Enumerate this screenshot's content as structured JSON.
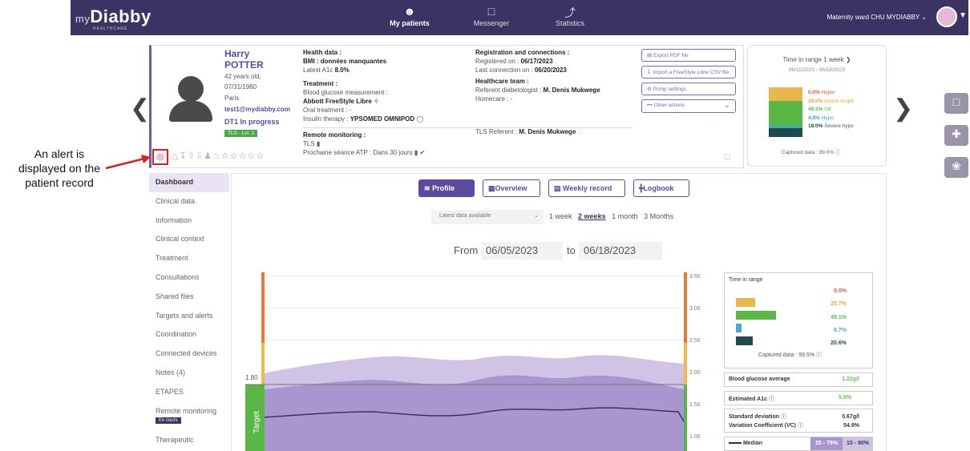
{
  "annotation": {
    "text_line1": "An alert is",
    "text_line2": "displayed on the",
    "text_line3": "patient record"
  },
  "topbar": {
    "logo_prefix": "my",
    "logo": "Diabby",
    "logo_sub": "HEALTHCARE",
    "tabs": [
      {
        "label": "My patients",
        "icon": "people-icon"
      },
      {
        "label": "Messenger",
        "icon": "chat-icon"
      },
      {
        "label": "Statistics",
        "icon": "chart-icon"
      }
    ],
    "ward": "Maternity ward CHU MYDIABBY"
  },
  "patient": {
    "first_name": "Harry",
    "last_name": "POTTER",
    "age": "42 years old,",
    "dob": "07/31/1980",
    "city": "Paris",
    "email": "test1@mydiabby.com",
    "type": "DT1",
    "status": "In progress",
    "tls_badge": "TLS - Lvl. 2"
  },
  "health": {
    "title": "Health data :",
    "bmi": "BMI : données manquantes",
    "a1c_label": "Latest A1c",
    "a1c": "8.0%",
    "treatment_title": "Treatment :",
    "bg_measure_label": "Blood glucose measurement :",
    "bg_device": "Abbott FreeStyle Libre",
    "oral": "Oral treatment : -",
    "insulin_label": "Insulin therapy :",
    "insulin": "YPSOMED OMNIPOD",
    "remote_title": "Remote monitoring :",
    "tls": "TLS",
    "next_session": "Prochaine séance ATP : Dans 30 jours"
  },
  "registration": {
    "title": "Registration and connections :",
    "registered_label": "Registered on :",
    "registered": "06/17/2023",
    "last_conn_label": "Last connection on :",
    "last_conn": "06/20/2023",
    "team_title": "Healthcare team :",
    "diabetologist_label": "Referent diabetologist :",
    "diabetologist": "M. Denis Mukwege",
    "homecare": "Homecare : -",
    "tls_ref_label": "TLS Referent :",
    "tls_ref": "M. Denis Mukwege"
  },
  "actions": {
    "export_pdf": "Export PDF file",
    "import_csv": "Import a FreeStyle Libre CSV file",
    "pump_settings": "Pump settings",
    "other_actions": "Other actions"
  },
  "tir_card": {
    "title": "Time in range 1 week",
    "dates": "06/11/2023 - 06/18/2023",
    "rows": [
      {
        "value": "0.0%",
        "label": "Hyper",
        "color": "#e05a3a"
      },
      {
        "value": "28.0%",
        "label": "Above target",
        "color": "#e8a93a"
      },
      {
        "value": "49.3%",
        "label": "OK",
        "color": "#59b845"
      },
      {
        "value": "4.8%",
        "label": "Hypo",
        "color": "#3fa8b8"
      },
      {
        "value": "18.0%",
        "label": "Severe hypo",
        "color": "#1f4a52"
      }
    ],
    "captured": "Captured data : 99.0%"
  },
  "leftnav": [
    "Dashboard",
    "Clinical data",
    "Information",
    "Clinical context",
    "Treatment",
    "Consultations",
    "Shared files",
    "Targets and alerts",
    "Coordination",
    "Connected devices",
    "Notes (4)",
    "ETAPES",
    "Remote monitoring",
    "Therapeutic"
  ],
  "remote_badge": "En cours",
  "views": [
    "Profile",
    "Overview",
    "Weekly record",
    "Logbook"
  ],
  "period": {
    "select": "Latest data available",
    "options": [
      "1 week",
      "2 weeks",
      "1 month",
      "3 Months"
    ],
    "active": "2 weeks",
    "from_label": "From",
    "from": "06/05/2023",
    "to_label": "to",
    "to": "06/18/2023"
  },
  "chart": {
    "y_ticks": [
      "3.50",
      "3.00",
      "2.50",
      "2.00",
      "1.50",
      "1.00"
    ],
    "target_low_label": "1.80",
    "target_label": "Target"
  },
  "tir_table": {
    "title": "Time in range",
    "rows": [
      {
        "value": "0.0%",
        "color": "#e05a3a"
      },
      {
        "value": "23.7%",
        "color": "#e8b84a"
      },
      {
        "value": "49.1%",
        "color": "#59b845"
      },
      {
        "value": "6.7%",
        "color": "#4aa8d8"
      },
      {
        "value": "20.6%",
        "color": "#1f4a52"
      }
    ],
    "captured": "Captured data : 99.5%",
    "bg_avg_label": "Blood glucose average",
    "bg_avg": "1.22g/l",
    "a1c_label": "Estimated A1c",
    "a1c": "5.9%",
    "sd_label": "Standard deviation",
    "sd": "0.67g/l",
    "vc_label": "Variation Coefficient (VC)",
    "vc": "54.9%",
    "median_label": "Median",
    "p25": "25 - 75%",
    "p10": "10 - 90%"
  }
}
